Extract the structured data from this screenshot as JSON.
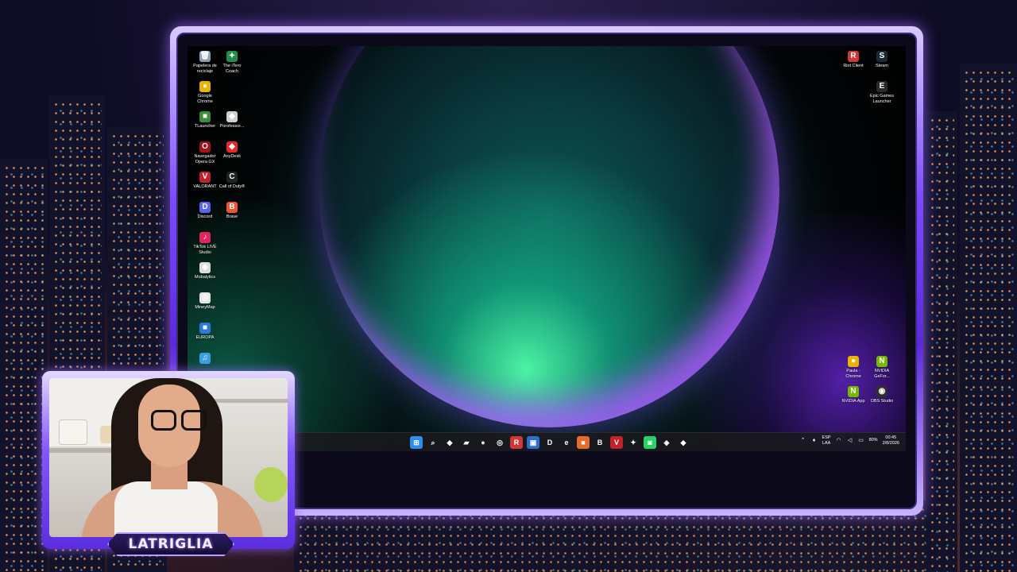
{
  "desktop": {
    "left_icons": [
      {
        "id": "recycle",
        "label": "Papelera de reciclaje",
        "icon": "recycle-bin-icon",
        "color": "#8aa0b8",
        "glyph": "🗑"
      },
      {
        "id": "itero",
        "label": "The iTero Coach",
        "icon": "itero-coach-icon",
        "color": "#1f8f4a",
        "glyph": "✦"
      },
      {
        "id": "chrome",
        "label": "Google Chrome",
        "icon": "chrome-icon",
        "color": "#e8b400",
        "glyph": "●"
      },
      {
        "id": "tlauncher",
        "label": "TLauncher",
        "icon": "tlauncher-icon",
        "color": "#3c8f3a",
        "glyph": "■"
      },
      {
        "id": "porofessor",
        "label": "Porofessor...",
        "icon": "porofessor-icon",
        "color": "#cfcfcf",
        "glyph": "◆"
      },
      {
        "id": "operagx",
        "label": "Navegador Opera GX",
        "icon": "opera-gx-icon",
        "color": "#a3111b",
        "glyph": "O"
      },
      {
        "id": "anydesk",
        "label": "AnyDesk",
        "icon": "anydesk-icon",
        "color": "#e5262b",
        "glyph": "◆"
      },
      {
        "id": "valorant",
        "label": "VALORANT",
        "icon": "valorant-icon",
        "color": "#c4222a",
        "glyph": "V"
      },
      {
        "id": "cod",
        "label": "Call of Duty®",
        "icon": "call-of-duty-icon",
        "color": "#222",
        "glyph": "C"
      },
      {
        "id": "discord",
        "label": "Discord",
        "icon": "discord-icon",
        "color": "#5865f2",
        "glyph": "D"
      },
      {
        "id": "brave",
        "label": "Brave",
        "icon": "brave-icon",
        "color": "#f0532f",
        "glyph": "B"
      },
      {
        "id": "tiktok",
        "label": "TikTok LIVE Studio",
        "icon": "tiktok-live-icon",
        "color": "#e0245e",
        "glyph": "♪"
      },
      {
        "id": "mobalytics",
        "label": "Mobalytics",
        "icon": "mobalytics-icon",
        "color": "#dcdcdc",
        "glyph": "◈"
      },
      {
        "id": "mineymap",
        "label": "MineyMap",
        "icon": "mineymap-icon",
        "color": "#e5e5e5",
        "glyph": "◎"
      },
      {
        "id": "europa",
        "label": "EUROPA",
        "icon": "europa-icon",
        "color": "#2a7bd4",
        "glyph": "■"
      },
      {
        "id": "partial",
        "label": "",
        "icon": "app-icon",
        "color": "#3aa0e0",
        "glyph": "♫"
      }
    ],
    "right_icons": [
      {
        "id": "riot",
        "label": "Riot Client",
        "icon": "riot-client-icon",
        "color": "#d13639",
        "glyph": "R"
      },
      {
        "id": "steam",
        "label": "Steam",
        "icon": "steam-icon",
        "color": "#1b2838",
        "glyph": "S"
      },
      {
        "id": "epic",
        "label": "Epic Games Launcher",
        "icon": "epic-games-icon",
        "color": "#2a2a2a",
        "glyph": "E"
      },
      {
        "id": "paula_chrome",
        "label": "Paula - Chrome",
        "icon": "chrome-profile-icon",
        "color": "#e8b400",
        "glyph": "●"
      },
      {
        "id": "nvidia_geforce",
        "label": "NVIDIA GeFor...",
        "icon": "nvidia-geforce-icon",
        "color": "#76b900",
        "glyph": "N"
      },
      {
        "id": "nvidia_app",
        "label": "NVIDIA App",
        "icon": "nvidia-app-icon",
        "color": "#76b900",
        "glyph": "N"
      },
      {
        "id": "obs",
        "label": "OBS Studio",
        "icon": "obs-icon",
        "color": "#302e31",
        "glyph": "◉"
      }
    ]
  },
  "taskbar": {
    "apps": [
      {
        "name": "start",
        "icon": "windows-start-icon",
        "color": "#2b8df0",
        "glyph": "⊞"
      },
      {
        "name": "search",
        "icon": "search-icon",
        "color": "transparent",
        "glyph": "⌕"
      },
      {
        "name": "diamond",
        "icon": "app-diamond-icon",
        "color": "transparent",
        "glyph": "◆"
      },
      {
        "name": "explorer",
        "icon": "file-explorer-icon",
        "color": "transparent",
        "glyph": "▰"
      },
      {
        "name": "chrome",
        "icon": "chrome-icon",
        "color": "transparent",
        "glyph": "●"
      },
      {
        "name": "chrome2",
        "icon": "chrome-profile-icon",
        "color": "transparent",
        "glyph": "◎"
      },
      {
        "name": "riot",
        "icon": "riot-client-icon",
        "color": "#d13639",
        "glyph": "R"
      },
      {
        "name": "outlook",
        "icon": "app-blue-icon",
        "color": "#2a6fd0",
        "glyph": "▣"
      },
      {
        "name": "discord",
        "icon": "discord-icon",
        "color": "transparent",
        "glyph": "D"
      },
      {
        "name": "edge",
        "icon": "edge-icon",
        "color": "transparent",
        "glyph": "e"
      },
      {
        "name": "paint",
        "icon": "paint-icon",
        "color": "#e86a2b",
        "glyph": "■"
      },
      {
        "name": "brave",
        "icon": "brave-icon",
        "color": "transparent",
        "glyph": "B"
      },
      {
        "name": "valorant",
        "icon": "valorant-icon",
        "color": "#c4222a",
        "glyph": "V"
      },
      {
        "name": "itero",
        "icon": "itero-coach-icon",
        "color": "transparent",
        "glyph": "✦"
      },
      {
        "name": "whatsapp",
        "icon": "whatsapp-icon",
        "color": "#25d366",
        "glyph": "◙"
      },
      {
        "name": "mobalytics",
        "icon": "mobalytics-icon",
        "color": "transparent",
        "glyph": "◈"
      },
      {
        "name": "porofessor",
        "icon": "porofessor-icon",
        "color": "transparent",
        "glyph": "◆"
      }
    ],
    "tray": {
      "lang_top": "ESP",
      "lang_bottom": "LAA",
      "battery": "80%",
      "time": "00:45",
      "date": "2/8/2026"
    }
  },
  "webcam": {
    "streamer_name": "LATRIGLIA"
  },
  "colors": {
    "frame_accent": "#7b4cff",
    "taskbar_bg": "#19191e"
  }
}
